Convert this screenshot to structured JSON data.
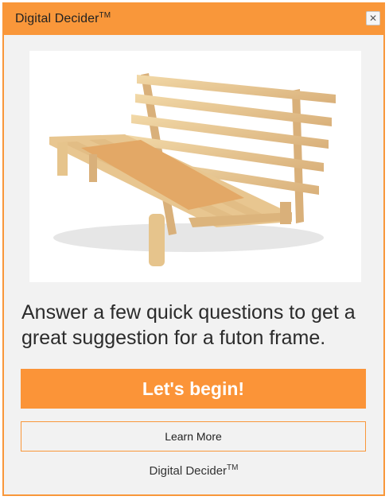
{
  "header": {
    "title": "Digital Decider",
    "title_mark": "TM",
    "close_icon": "close-x-icon"
  },
  "image": {
    "subject": "futon-frame-photo"
  },
  "prompt_text": "Answer a few quick questions to get a great suggestion for a futon frame.",
  "buttons": {
    "begin_label": "Let's begin!",
    "learn_more_label": "Learn More"
  },
  "footer": {
    "brand": "Digital Decider",
    "brand_mark": "TM"
  },
  "colors": {
    "accent": "#f9973a",
    "cta": "#fb9438",
    "background": "#f2f2f2"
  }
}
